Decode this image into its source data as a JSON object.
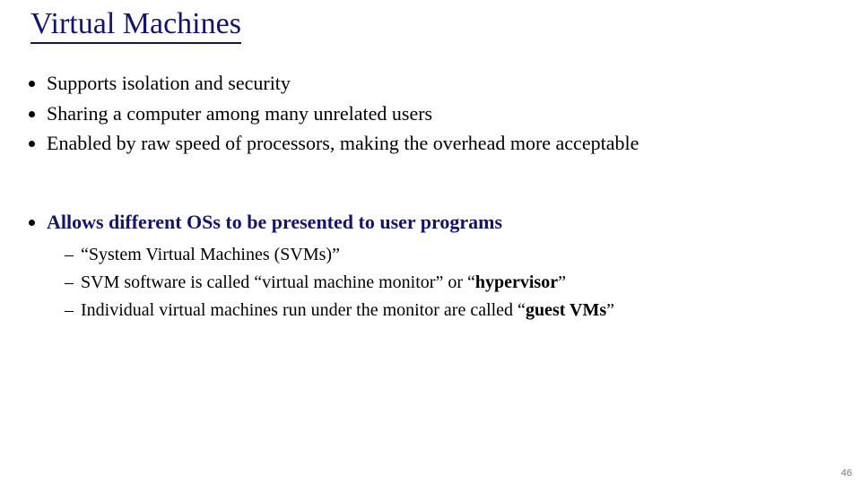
{
  "title": "Virtual Machines",
  "bullets": {
    "b1": "Supports isolation and security",
    "b2": "Sharing a computer among many unrelated users",
    "b3": "Enabled by raw speed of processors, making the overhead more acceptable",
    "b4": "Allows different OSs to be presented to user programs"
  },
  "sub": {
    "s1a": "“System Virtual Machines (SVMs)”",
    "s2a": "SVM software is called “virtual machine monitor” or “",
    "s2b": "hypervisor",
    "s2c": "”",
    "s3a": "Individual virtual machines run under the monitor are called “",
    "s3b": "guest VMs",
    "s3c": "”"
  },
  "page": "46"
}
